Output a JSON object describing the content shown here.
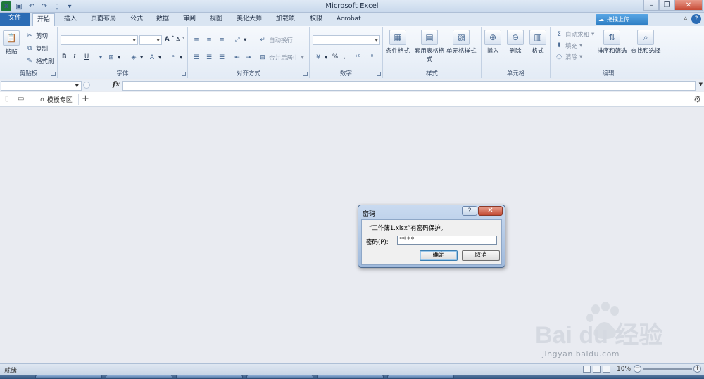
{
  "window": {
    "app_title": "Microsoft Excel",
    "upload_label": "拖拽上传"
  },
  "tabs": [
    {
      "label": "文件"
    },
    {
      "label": "开始"
    },
    {
      "label": "插入"
    },
    {
      "label": "页面布局"
    },
    {
      "label": "公式"
    },
    {
      "label": "数据"
    },
    {
      "label": "审阅"
    },
    {
      "label": "视图"
    },
    {
      "label": "美化大师"
    },
    {
      "label": "加载项"
    },
    {
      "label": "权限"
    },
    {
      "label": "Acrobat"
    }
  ],
  "ribbon": {
    "clipboard": {
      "paste": "粘贴",
      "cut": "剪切",
      "copy": "复制",
      "format_painter": "格式刷",
      "label": "剪贴板"
    },
    "font": {
      "label": "字体",
      "bold": "B",
      "italic": "I",
      "underline": "U",
      "grow": "A",
      "shrink": "A"
    },
    "alignment": {
      "wrap": "自动换行",
      "merge": "合并后居中",
      "label": "对齐方式"
    },
    "number": {
      "label": "数字",
      "percent": "%",
      "comma": ","
    },
    "styles": {
      "conditional": "条件格式",
      "table": "套用表格格式",
      "cell_styles": "单元格样式",
      "label": "样式"
    },
    "cells": {
      "insert": "插入",
      "delete": "删除",
      "format": "格式",
      "label": "单元格"
    },
    "editing": {
      "autosum": "自动求和",
      "fill": "填充",
      "clear": "清除",
      "sort": "排序和筛选",
      "find": "查找和选择",
      "label": "编辑"
    }
  },
  "formula_bar": {
    "fx": "fx"
  },
  "template_bar": {
    "tab_label": "模板专区",
    "add": "+"
  },
  "dialog": {
    "title": "密码",
    "help": "?",
    "close": "✕",
    "message": "“工作簿1.xlsx”有密码保护。",
    "password_label": "密码(P):",
    "password_value": "****",
    "ok": "确定",
    "cancel": "取消"
  },
  "watermark": {
    "brand": "Bai du 经验",
    "url": "jingyan.baidu.com"
  },
  "status": {
    "ready": "就绪",
    "zoom": "10%"
  },
  "colors": {
    "file_tab": "#2b6cb5",
    "close_button": "#c74b36",
    "dialog_frame": "#9fb9db"
  }
}
